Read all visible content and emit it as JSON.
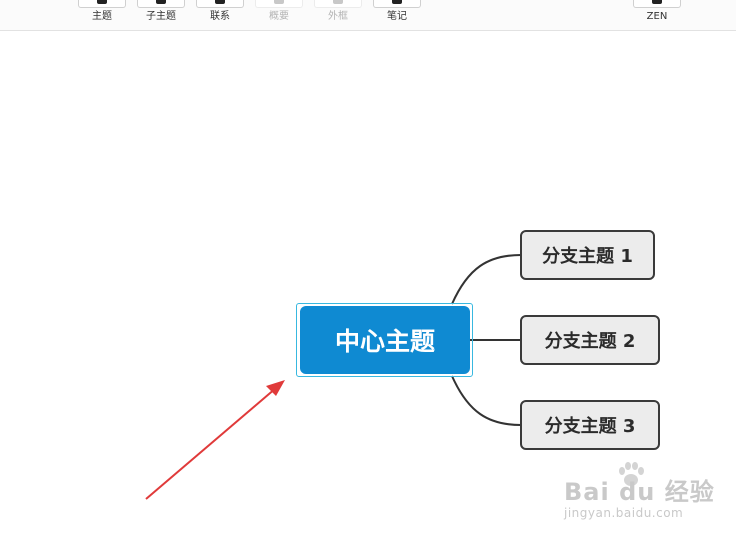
{
  "toolbar": {
    "items": [
      {
        "label": "主题",
        "enabled": true
      },
      {
        "label": "子主题",
        "enabled": true
      },
      {
        "label": "联系",
        "enabled": true
      },
      {
        "label": "概要",
        "enabled": false
      },
      {
        "label": "外框",
        "enabled": false
      },
      {
        "label": "笔记",
        "enabled": true
      },
      {
        "label": "ZEN",
        "enabled": true
      }
    ]
  },
  "mindmap": {
    "central_topic": "中心主题",
    "branches": [
      {
        "label": "分支主题 1"
      },
      {
        "label": "分支主题 2"
      },
      {
        "label": "分支主题 3"
      }
    ]
  },
  "watermark": {
    "brand": "Bai du 经验",
    "url": "jingyan.baidu.com"
  },
  "colors": {
    "central_fill": "#0f8ad2",
    "selection_outline": "#38b8e0",
    "branch_fill": "#ececec",
    "branch_border": "#3a3a3a",
    "annotation_arrow": "#e03a3a"
  }
}
